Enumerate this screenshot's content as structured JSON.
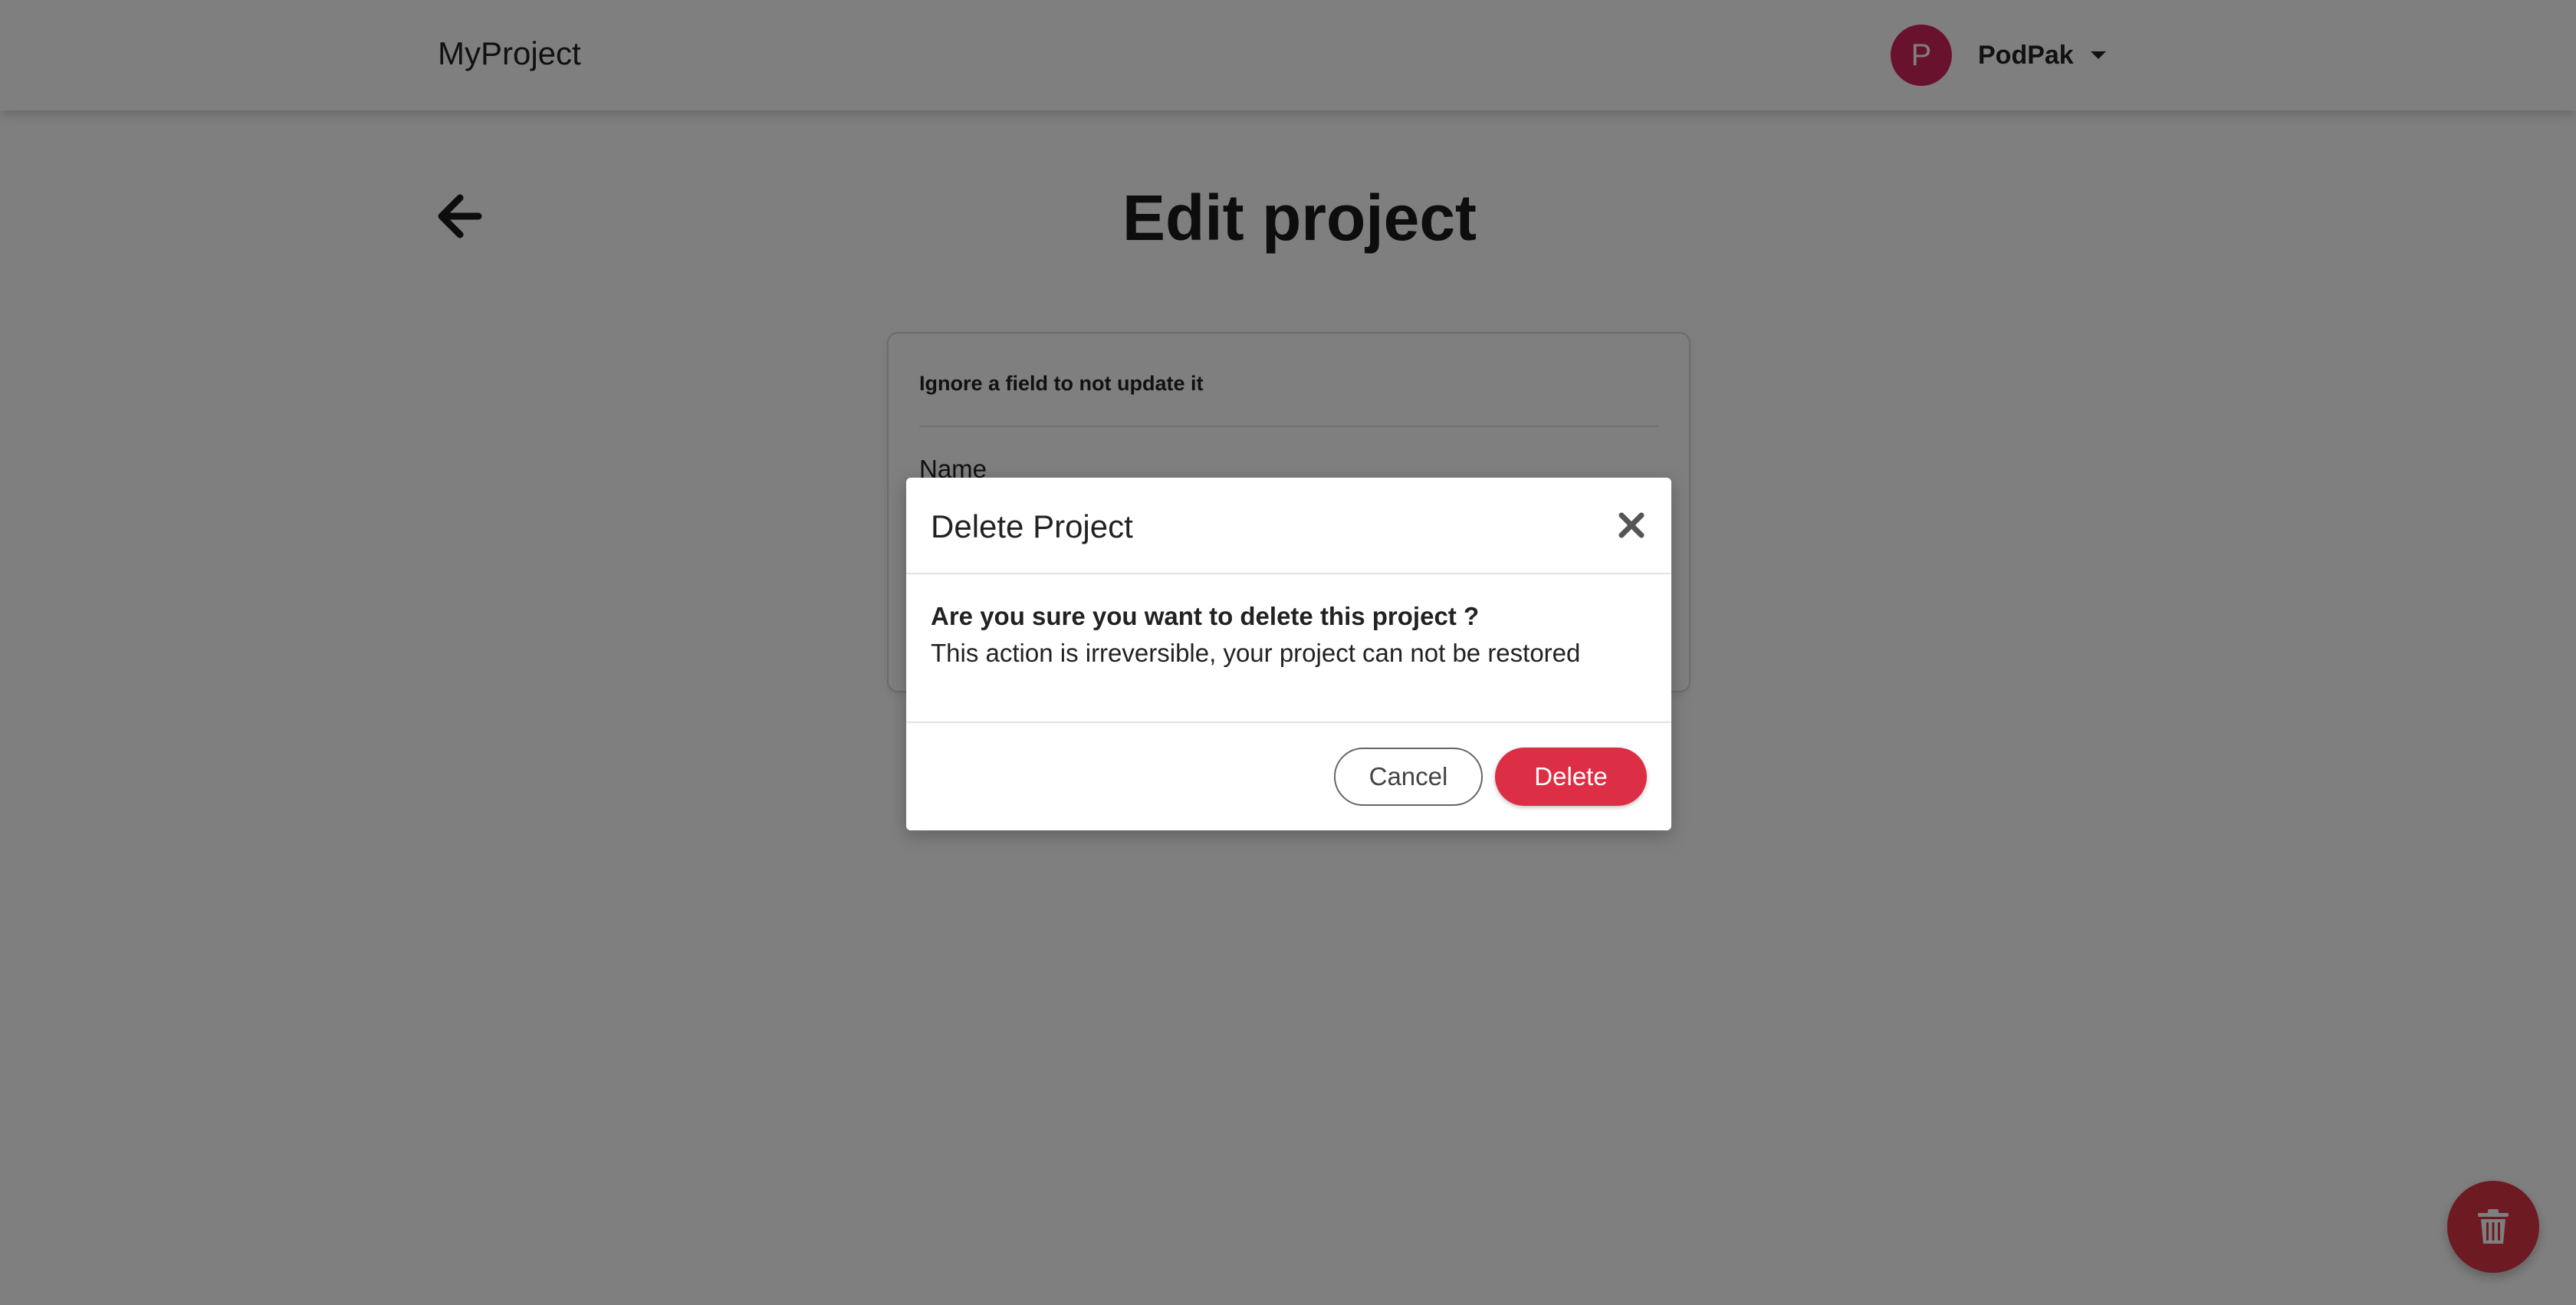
{
  "navbar": {
    "brand": "MyProject",
    "user": {
      "avatar_initial": "P",
      "name": "PodPak"
    }
  },
  "page": {
    "title": "Edit project"
  },
  "form": {
    "hint": "Ignore a field to not update it",
    "name_label": "Name"
  },
  "modal": {
    "title": "Delete Project",
    "question": "Are you sure you want to delete this project ?",
    "warning": "This action is irreversible, your project can not be restored",
    "cancel_label": "Cancel",
    "delete_label": "Delete"
  },
  "icons": {
    "back": "arrow-left-icon",
    "close": "close-icon",
    "dropdown": "caret-down-icon",
    "fab": "trash-icon"
  },
  "colors": {
    "avatar": "#d3245c",
    "danger": "#dc3545",
    "overlay": "rgba(0,0,0,0.5)"
  }
}
